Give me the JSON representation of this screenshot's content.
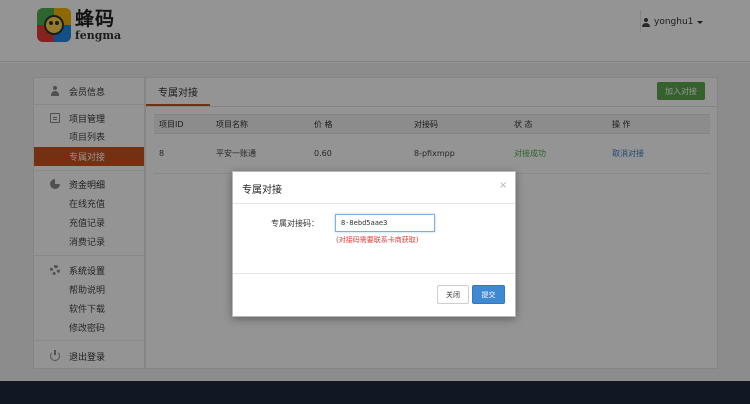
{
  "header": {
    "logo_cn": "蜂码",
    "logo_en": "fengma",
    "username": "yonghu1"
  },
  "sidebar": {
    "profile": "会员信息",
    "project_group": "项目管理",
    "project_list": "项目列表",
    "dedicated": "专属对接",
    "fund_group": "资金明细",
    "recharge_online": "在线充值",
    "recharge_log": "充值记录",
    "consume_log": "消费记录",
    "system_group": "系统设置",
    "help": "帮助说明",
    "download": "软件下载",
    "change_pwd": "修改密码",
    "logout": "退出登录"
  },
  "main": {
    "title": "专属对接",
    "join_button": "加入对接",
    "table": {
      "headers": [
        "项目ID",
        "项目名称",
        "价 格",
        "对接码",
        "状 态",
        "操 作"
      ],
      "rows": [
        {
          "id": "8",
          "name": "平安一账通",
          "price": "0.60",
          "code": "8-pfixmpp",
          "status": "对接成功",
          "action": "取消对接"
        }
      ]
    }
  },
  "modal": {
    "title": "专属对接",
    "close_symbol": "×",
    "field_label": "专属对接码：",
    "field_value": "8-8ebd5aae3",
    "hint": "(对接码需要联系卡商获取)",
    "close_button": "关闭",
    "submit_button": "提交"
  },
  "colors": {
    "accent": "#c9541e",
    "success": "#5aa84c",
    "primary": "#3f89d3",
    "footer": "#1e2a3e"
  }
}
